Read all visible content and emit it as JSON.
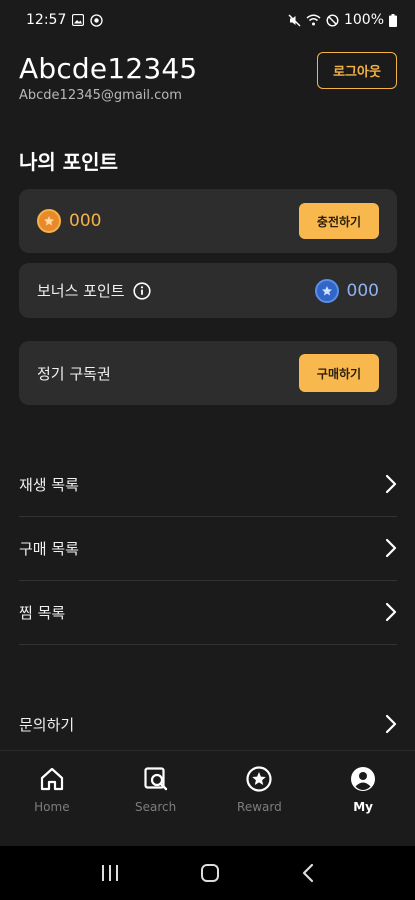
{
  "status": {
    "time": "12:57",
    "battery": "100%"
  },
  "profile": {
    "username": "Abcde12345",
    "email": "Abcde12345@gmail.com",
    "logout_label": "로그아웃"
  },
  "points": {
    "section_title": "나의 포인트",
    "value": "000",
    "charge_label": "충전하기"
  },
  "bonus": {
    "label": "보너스 포인트",
    "value": "000"
  },
  "subscription": {
    "label": "정기 구독권",
    "buy_label": "구매하기"
  },
  "menu": {
    "items": [
      {
        "label": "재생 목록"
      },
      {
        "label": "구매 목록"
      },
      {
        "label": "찜 목록"
      },
      {
        "label": "문의하기"
      }
    ]
  },
  "nav": {
    "items": [
      {
        "label": "Home",
        "icon": "home-icon"
      },
      {
        "label": "Search",
        "icon": "search-icon"
      },
      {
        "label": "Reward",
        "icon": "star-icon"
      },
      {
        "label": "My",
        "icon": "user-icon"
      }
    ],
    "active": "My"
  },
  "colors": {
    "accent": "#f8b84e",
    "background": "#1b1b1b",
    "card": "#2d2d2d"
  }
}
